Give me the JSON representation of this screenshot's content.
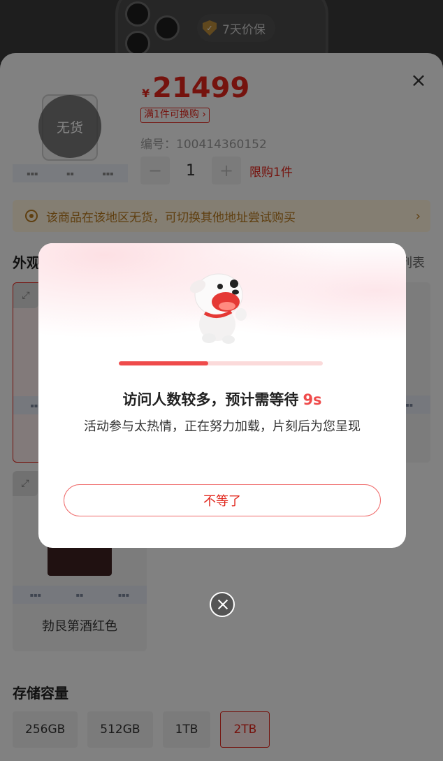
{
  "header": {
    "guarantee_badge": "7天价保",
    "guarantee_icon": "shield-check-icon"
  },
  "product": {
    "currency": "¥",
    "price": "21499",
    "promo_tag": "满1件可换购",
    "sku_label": "编号：100414360152",
    "stock_status": "无货",
    "quantity": "1",
    "purchase_limit": "限购1件",
    "decrement_symbol": "−",
    "increment_symbol": "+"
  },
  "notice": {
    "text": "该商品在该地区无货，可切换其他地址尝试购买"
  },
  "appearance": {
    "title": "外观",
    "list_toggle": "列表",
    "visible_variant_label": "勃艮第酒红色"
  },
  "storage": {
    "title": "存储容量",
    "options": [
      "256GB",
      "512GB",
      "1TB",
      "2TB"
    ],
    "selected": "2TB"
  },
  "modal": {
    "progress": 0.44,
    "title": "访问人数较多，预计需等待",
    "wait_seconds": "9s",
    "subtitle": "活动参与太热情，正在努力加载，片刻后为您呈现",
    "dismiss_label": "不等了",
    "mascot_icon": "jd-dog-mascot-icon"
  },
  "colors": {
    "accent": "#e1251b",
    "progress": "#ef4b4b",
    "notice_bg": "#fdf1da",
    "notice_text": "#b7791f"
  }
}
